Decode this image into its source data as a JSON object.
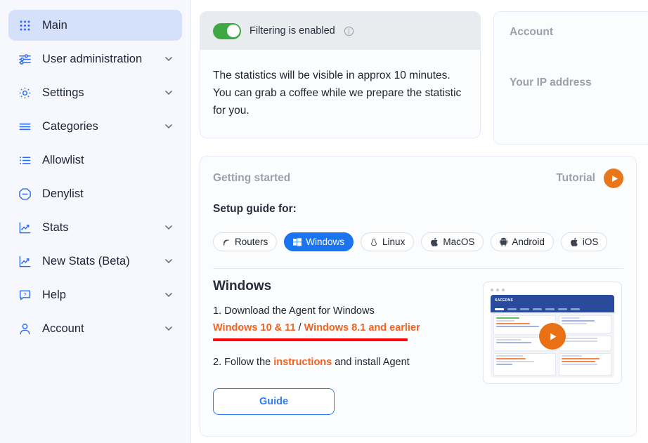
{
  "sidebar": {
    "items": [
      {
        "label": "Main",
        "icon": "grid-dots-icon",
        "active": true,
        "chevron": false
      },
      {
        "label": "User administration",
        "icon": "sliders-icon",
        "active": false,
        "chevron": true
      },
      {
        "label": "Settings",
        "icon": "gear-icon",
        "active": false,
        "chevron": true
      },
      {
        "label": "Categories",
        "icon": "menu-lines-icon",
        "active": false,
        "chevron": true
      },
      {
        "label": "Allowlist",
        "icon": "list-check-icon",
        "active": false,
        "chevron": false
      },
      {
        "label": "Denylist",
        "icon": "octagon-minus-icon",
        "active": false,
        "chevron": false
      },
      {
        "label": "Stats",
        "icon": "chart-line-icon",
        "active": false,
        "chevron": true
      },
      {
        "label": "New Stats (Beta)",
        "icon": "chart-line-icon",
        "active": false,
        "chevron": true
      },
      {
        "label": "Help",
        "icon": "help-bubble-icon",
        "active": false,
        "chevron": true
      },
      {
        "label": "Account",
        "icon": "user-icon",
        "active": false,
        "chevron": true
      }
    ]
  },
  "filtering_card": {
    "toggle_state": "on",
    "toggle_label": "Filtering is enabled",
    "info_icon": "info-circle-icon",
    "body_text": "The statistics will be visible in approx 10 minutes. You can grab a coffee while we prepare the statistic for you."
  },
  "account_card": {
    "title": "Account",
    "ip_label": "Your IP address"
  },
  "getting_started": {
    "title": "Getting started",
    "tutorial_label": "Tutorial",
    "tutorial_icon": "play-icon",
    "setup_label": "Setup guide for:",
    "tabs": [
      {
        "label": "Routers",
        "icon": "rss-signal-icon",
        "active": false
      },
      {
        "label": "Windows",
        "icon": "windows-icon",
        "active": true
      },
      {
        "label": "Linux",
        "icon": "linux-penguin-icon",
        "active": false
      },
      {
        "label": "MacOS",
        "icon": "apple-icon",
        "active": false
      },
      {
        "label": "Android",
        "icon": "android-icon",
        "active": false
      },
      {
        "label": "iOS",
        "icon": "apple-icon",
        "active": false
      }
    ],
    "os_heading": "Windows",
    "step1_text": "1. Download the Agent for Windows",
    "link_modern": "Windows 10 & 11",
    "link_separator": " / ",
    "link_legacy": "Windows 8.1 and earlier",
    "step2_prefix": "2. Follow the ",
    "step2_link": "instructions",
    "step2_suffix": " and install Agent",
    "guide_button": "Guide",
    "video_logo": "SAFEDNS",
    "video_play_icon": "play-icon"
  },
  "colors": {
    "accent_blue": "#1a73ef",
    "sidebar_active": "#d5e0fb",
    "toggle_green": "#3ea845",
    "orange": "#e8771c",
    "link_orange": "#f4621f",
    "annotation_red": "#ff0707"
  }
}
